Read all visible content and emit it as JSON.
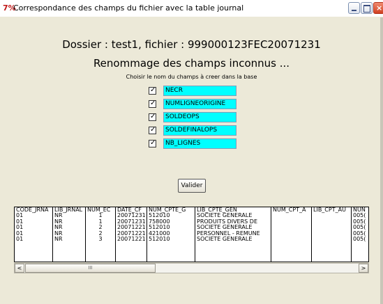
{
  "window": {
    "app_icon": "7%",
    "title": "Correspondance des champs du fichier avec la table journal",
    "minimize_icon": "minimize-icon",
    "maximize_icon": "maximize-icon",
    "close_icon": "close-icon",
    "close_glyph": "×"
  },
  "header": {
    "line1": "Dossier : test1, fichier : 999000123FEC20071231",
    "line2": "Renommage des champs inconnus  ...",
    "instruction": "Choisir le nom du champs à creer dans la base"
  },
  "fields": [
    {
      "checked": true,
      "value": "NECR"
    },
    {
      "checked": true,
      "value": "NUMLIGNEORIGINE"
    },
    {
      "checked": true,
      "value": "SOLDEOPS"
    },
    {
      "checked": true,
      "value": "SOLDEFINALOPS"
    },
    {
      "checked": true,
      "value": "NB_LIGNES"
    }
  ],
  "colors": {
    "field_background": "#00ffff",
    "window_background": "#ece9d8"
  },
  "valider_label": "Valider",
  "grid": {
    "columns": [
      {
        "header": "CODE_JRNA",
        "cells": [
          "01",
          "01",
          "01",
          "01",
          "01"
        ]
      },
      {
        "header": "LIB_JRNAL",
        "cells": [
          "NR",
          "NR",
          "NR",
          "NR",
          "NR"
        ]
      },
      {
        "header": "NUM_EC",
        "cells": [
          "1",
          "1",
          "2",
          "2",
          "3"
        ]
      },
      {
        "header": "DATE_CF",
        "cells": [
          "20071231",
          "20071231",
          "20071221",
          "20071221",
          "20071221"
        ]
      },
      {
        "header": "NUM_CPTE_G",
        "cells": [
          "512010",
          "758000",
          "512010",
          "421000",
          "512010"
        ]
      },
      {
        "header": "LIB_CPTE_GEN",
        "cells": [
          "SOCIETE GENERALE",
          "PRODUITS DIVERS DE",
          "SOCIETE GENERALE",
          "PERSONNEL - REMUNE",
          "SOCIETE GENERALE"
        ]
      },
      {
        "header": "NUM_CPT_A",
        "cells": [
          "",
          "",
          "",
          "",
          ""
        ]
      },
      {
        "header": "LIB_CPT_AU",
        "cells": [
          "",
          "",
          "",
          "",
          ""
        ]
      },
      {
        "header": "NUN",
        "cells": [
          "005(",
          "005(",
          "005(",
          "005(",
          "005("
        ]
      }
    ]
  },
  "scrollbar": {
    "left_arrow": "<",
    "right_arrow": ">",
    "thumb_grip": "III"
  }
}
